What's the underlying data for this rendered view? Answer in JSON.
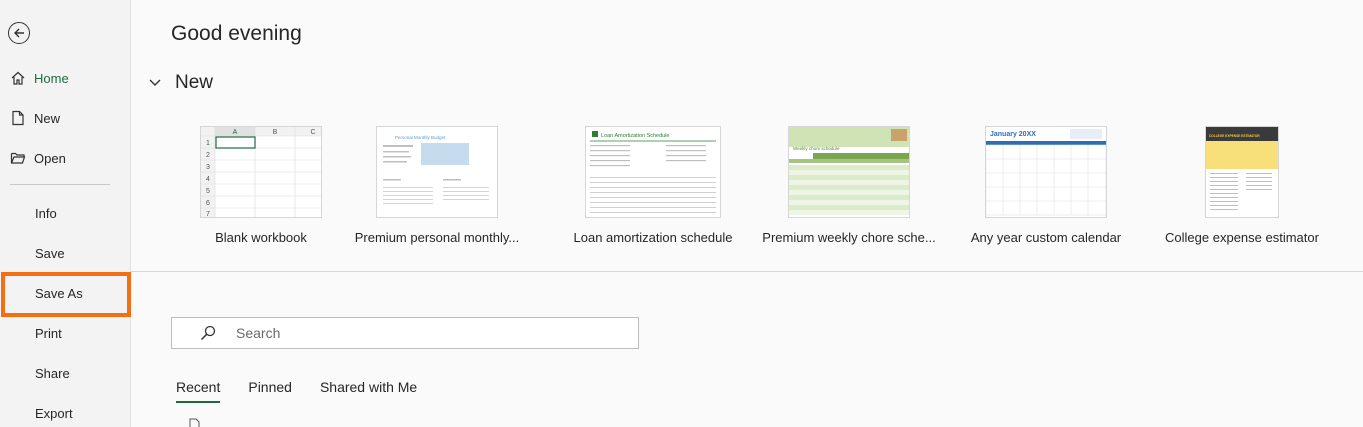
{
  "sidebar": {
    "items": [
      {
        "label": "Home",
        "icon": "home-icon"
      },
      {
        "label": "New",
        "icon": "new-document-icon"
      },
      {
        "label": "Open",
        "icon": "open-folder-icon"
      }
    ],
    "plain_items": [
      "Info",
      "Save",
      "Save As",
      "Print",
      "Share",
      "Export"
    ],
    "highlighted": "Save As"
  },
  "main": {
    "greeting": "Good evening",
    "new_section_label": "New",
    "templates": [
      {
        "label": "Blank workbook"
      },
      {
        "label": "Premium personal monthly..."
      },
      {
        "label": "Loan amortization schedule"
      },
      {
        "label": "Premium weekly chore sche..."
      },
      {
        "label": "Any year custom calendar"
      },
      {
        "label": "College expense estimator"
      }
    ],
    "search": {
      "placeholder": "Search"
    },
    "tabs": [
      "Recent",
      "Pinned",
      "Shared with Me"
    ],
    "active_tab": "Recent"
  },
  "thumbs": {
    "blank_cols": [
      "A",
      "B",
      "C"
    ],
    "blank_rows": [
      "1",
      "2",
      "3",
      "4",
      "5",
      "6",
      "7"
    ],
    "budget_title": "Personal Monthly Budget",
    "loan_title": "Loan Amortization Schedule",
    "chore_title": "Weekly chore schedule",
    "calendar_title": "January 20XX",
    "college_title": "COLLEGE EXPENSE ESTIMATOR"
  },
  "colors": {
    "accent": "#1e6b3f",
    "highlight": "#f36f16"
  }
}
